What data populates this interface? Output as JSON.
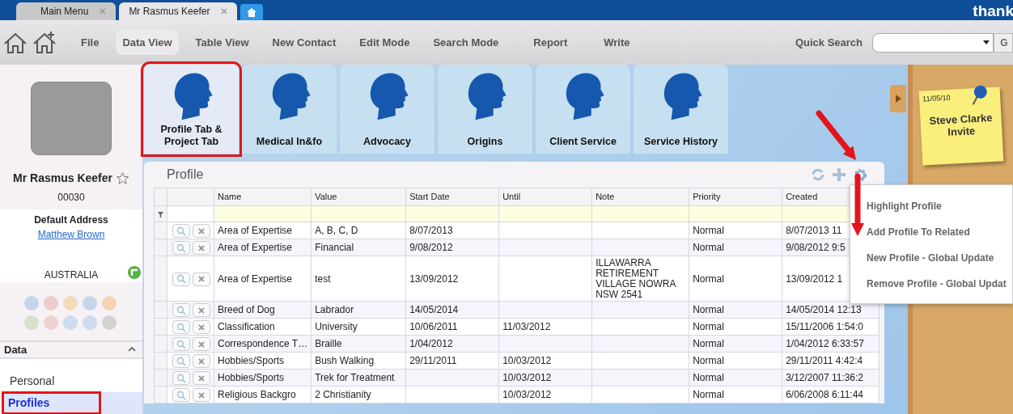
{
  "browser_tabs": [
    {
      "label": "Main Menu",
      "selected": false
    },
    {
      "label": "Mr Rasmus Keefer",
      "selected": true
    }
  ],
  "brand": "thank",
  "toolbar": {
    "items": [
      {
        "label": "File",
        "selected": false
      },
      {
        "label": "Data View",
        "selected": true
      },
      {
        "label": "Table View",
        "selected": false
      },
      {
        "label": "New Contact",
        "selected": false
      },
      {
        "label": "Edit Mode",
        "selected": false
      },
      {
        "label": "Search Mode",
        "selected": false
      },
      {
        "label": "Report",
        "selected": false
      },
      {
        "label": "Write",
        "selected": false
      }
    ],
    "quick_search": {
      "label": "Quick Search",
      "button": "G"
    }
  },
  "contact": {
    "name": "Mr Rasmus Keefer",
    "starred": false,
    "id": "00030",
    "address_heading": "Default Address",
    "address_link": "Matthew Brown",
    "country": "AUSTRALIA"
  },
  "sidebar": {
    "section": "Data",
    "expanded": true,
    "items": [
      {
        "label": "Personal",
        "selected": false,
        "highlighted": false
      },
      {
        "label": "Profiles",
        "selected": true,
        "highlighted": true
      }
    ]
  },
  "view_tabs": [
    {
      "label": "Profile Tab & Project Tab",
      "selected": true,
      "highlighted": true
    },
    {
      "label": "Medical In&fo",
      "selected": false,
      "highlighted": false
    },
    {
      "label": "Advocacy",
      "selected": false,
      "highlighted": false
    },
    {
      "label": "Origins",
      "selected": false,
      "highlighted": false
    },
    {
      "label": "Client Service",
      "selected": false,
      "highlighted": false
    },
    {
      "label": "Service History",
      "selected": false,
      "highlighted": false
    }
  ],
  "panel": {
    "title": "Profile",
    "table": {
      "columns": [
        "Name",
        "Value",
        "Start Date",
        "Until",
        "Note",
        "Priority",
        "Created"
      ],
      "rows": [
        {
          "cells": [
            "Area of Expertise",
            "A, B, C, D",
            "8/07/2013",
            "",
            "",
            "Normal",
            "8/07/2013 11"
          ]
        },
        {
          "cells": [
            "Area of Expertise",
            "Financial",
            "9/08/2012",
            "",
            "",
            "Normal",
            "9/08/2012 9:5"
          ]
        },
        {
          "cells": [
            "Area of Expertise",
            "test",
            "13/09/2012",
            "",
            "ILLAWARRA RETIREMENT VILLAGE NOWRA NSW 2541",
            "Normal",
            "13/09/2012 1"
          ]
        },
        {
          "cells": [
            "Breed of Dog",
            "Labrador",
            "14/05/2014",
            "",
            "",
            "Normal",
            "14/05/2014 12:13"
          ]
        },
        {
          "cells": [
            "Classification",
            "University",
            "10/06/2011",
            "11/03/2012",
            "",
            "Normal",
            "15/11/2006 1:54:0"
          ]
        },
        {
          "cells": [
            "Correspondence T…",
            "Braille",
            "1/04/2012",
            "",
            "",
            "Normal",
            "1/04/2012 6:33:57"
          ]
        },
        {
          "cells": [
            "Hobbies/Sports",
            "Bush Walking",
            "29/11/2011",
            "10/03/2012",
            "",
            "Normal",
            "29/11/2011 4:42:4"
          ]
        },
        {
          "cells": [
            "Hobbies/Sports",
            "Trek for Treatment",
            "",
            "10/03/2012",
            "",
            "Normal",
            "3/12/2007 11:36:2"
          ]
        },
        {
          "cells": [
            "Religious Backgro",
            "2 Christianity",
            "",
            "10/03/2012",
            "",
            "Normal",
            "6/06/2008 6:11:44"
          ]
        }
      ]
    }
  },
  "context_menu": {
    "items": [
      "Highlight Profile",
      "Add Profile To Related",
      "New Profile - Global Update",
      "Remove Profile - Global Updat"
    ]
  },
  "sticky_note": {
    "date": "11/05/10",
    "text": "Steve Clarke Invite"
  }
}
